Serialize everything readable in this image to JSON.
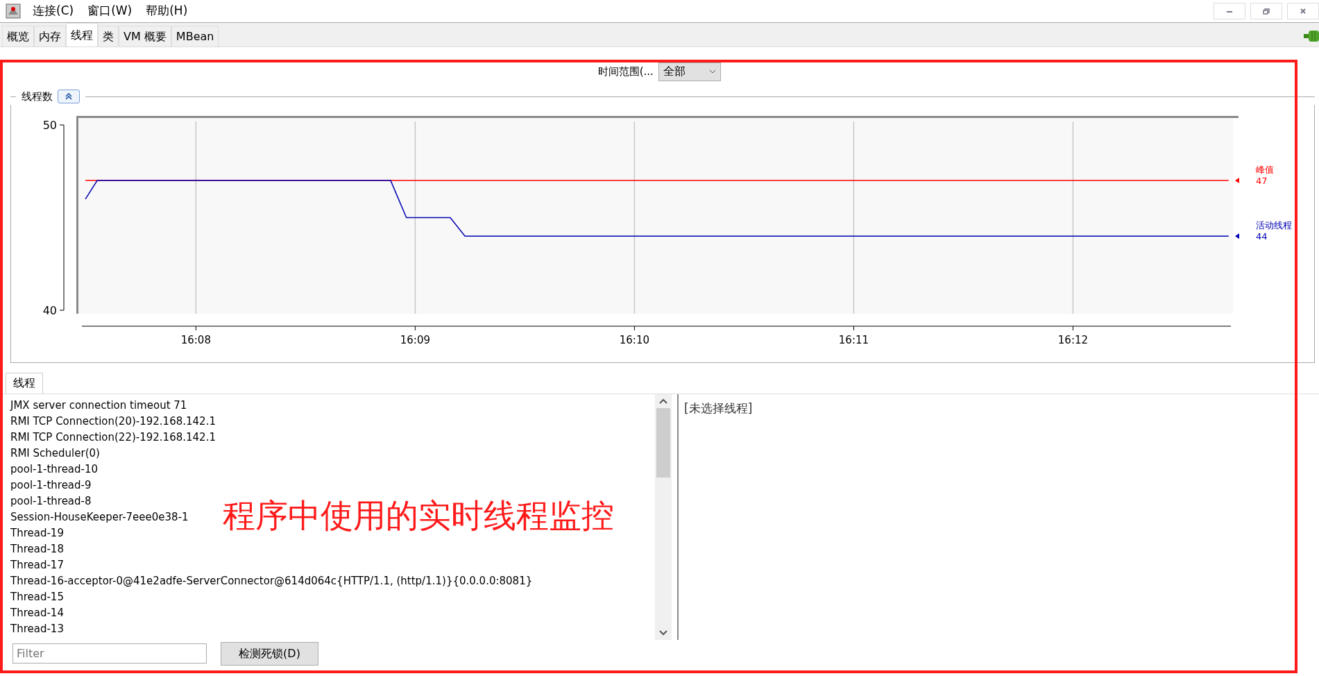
{
  "menu": [
    {
      "label": "连接(C)"
    },
    {
      "label": "窗口(W)"
    },
    {
      "label": "帮助(H)"
    }
  ],
  "tabs": [
    {
      "label": "概览",
      "selected": false
    },
    {
      "label": "内存",
      "selected": false
    },
    {
      "label": "线程",
      "selected": true
    },
    {
      "label": "类",
      "selected": false
    },
    {
      "label": "VM 概要",
      "selected": false
    },
    {
      "label": "MBean",
      "selected": false
    }
  ],
  "time_range": {
    "label": "时间范围(...",
    "value": "全部"
  },
  "chart": {
    "title": "线程数",
    "legend_values": [
      "47",
      "44"
    ],
    "chart_data": {
      "type": "line",
      "grid": true,
      "x": [
        967.496,
        967.55,
        968.888,
        968.96,
        969.16,
        969.227,
        972.71
      ],
      "xlim": [
        967.48,
        972.72
      ],
      "ylim": [
        40,
        50
      ],
      "yticks": [
        40,
        50
      ],
      "xticks": [
        {
          "value": 968,
          "label": "16:08"
        },
        {
          "value": 969,
          "label": "16:09"
        },
        {
          "value": 970,
          "label": "16:10"
        },
        {
          "value": 971,
          "label": "16:11"
        },
        {
          "value": 972,
          "label": "16:12"
        }
      ],
      "series": [
        {
          "name": "峰值",
          "color": "#ff0000",
          "values": [
            47,
            47,
            47,
            47,
            47,
            47,
            47
          ]
        },
        {
          "name": "活动线程",
          "color": "#0000b4",
          "values": [
            46,
            47,
            47,
            45,
            45,
            44,
            44
          ]
        }
      ]
    }
  },
  "threads_panel": {
    "tab": "线程",
    "threads": [
      "JMX server connection timeout 71",
      "RMI TCP Connection(20)-192.168.142.1",
      "RMI TCP Connection(22)-192.168.142.1",
      "RMI Scheduler(0)",
      "pool-1-thread-10",
      "pool-1-thread-9",
      "pool-1-thread-8",
      "Session-HouseKeeper-7eee0e38-1",
      "Thread-19",
      "Thread-18",
      "Thread-17",
      "Thread-16-acceptor-0@41e2adfe-ServerConnector@614d064c{HTTP/1.1, (http/1.1)}{0.0.0.0:8081}",
      "Thread-15",
      "Thread-14",
      "Thread-13"
    ],
    "detail": "[未选择线程]",
    "filter": {
      "placeholder": "Filter"
    },
    "button": "检测死锁(D)"
  },
  "annotation": {
    "text": "程序中使用的实时线程监控"
  }
}
